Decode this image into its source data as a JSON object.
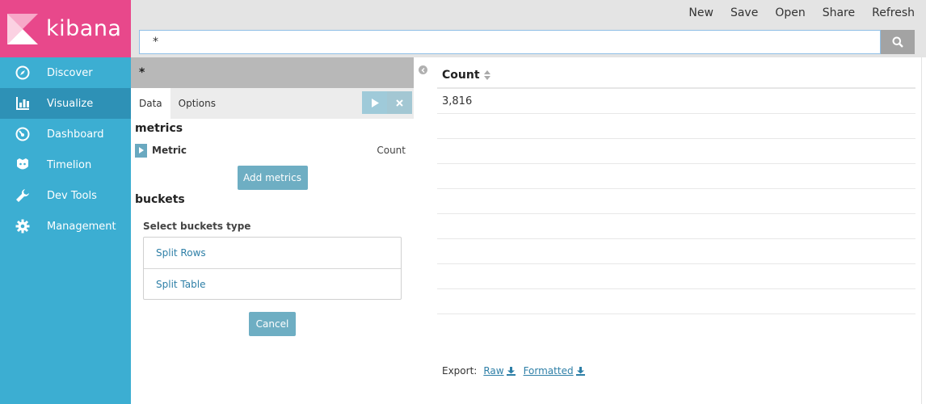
{
  "brand": {
    "name": "kibana"
  },
  "sidebar": {
    "items": [
      {
        "label": "Discover",
        "icon": "compass-icon",
        "active": false
      },
      {
        "label": "Visualize",
        "icon": "bar-chart-icon",
        "active": true
      },
      {
        "label": "Dashboard",
        "icon": "dashboard-icon",
        "active": false
      },
      {
        "label": "Timelion",
        "icon": "timelion-icon",
        "active": false
      },
      {
        "label": "Dev Tools",
        "icon": "wrench-icon",
        "active": false
      },
      {
        "label": "Management",
        "icon": "gear-icon",
        "active": false
      }
    ]
  },
  "topbar": {
    "menu": {
      "new": "New",
      "save": "Save",
      "open": "Open",
      "share": "Share",
      "refresh": "Refresh"
    },
    "query_value": "*"
  },
  "editor": {
    "title": "*",
    "tabs": {
      "data": "Data",
      "options": "Options"
    },
    "metrics_heading": "metrics",
    "metric": {
      "label": "Metric",
      "value": "Count"
    },
    "add_metrics": "Add metrics",
    "buckets_heading": "buckets",
    "select_buckets": "Select buckets type",
    "bucket_options": {
      "split_rows": "Split Rows",
      "split_table": "Split Table"
    },
    "cancel": "Cancel"
  },
  "results": {
    "column": "Count",
    "rows": [
      "3,816",
      "",
      "",
      "",
      "",
      "",
      "",
      "",
      ""
    ]
  },
  "export": {
    "label": "Export:",
    "raw": "Raw",
    "formatted": "Formatted"
  },
  "colors": {
    "brand_pink": "#e8488b",
    "sidebar_blue": "#3caed2",
    "active_blue": "#2e91b6",
    "link": "#2e7fa7"
  }
}
